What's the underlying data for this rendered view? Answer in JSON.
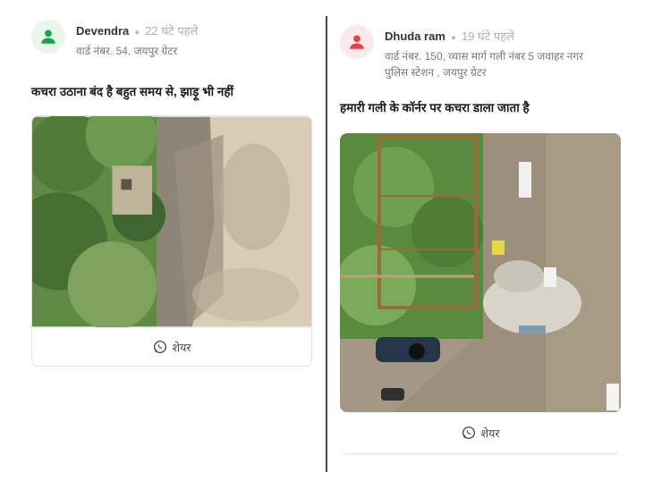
{
  "posts": [
    {
      "author": "Devendra",
      "time": "22 घंटे पहले",
      "ward": "वार्ड नंबर. 54, जयपुर ग्रेटर",
      "text": "कचरा उठाना बंद है बहुत समय से, झाड़ू भी नहीं",
      "share_label": "शेयर",
      "avatar_color": "#19a34a",
      "avatar_bg": "#e8f6ec",
      "avatar_icon": "user-icon"
    },
    {
      "author": "Dhuda ram",
      "time": "19 घंटे पहले",
      "ward_line1": "वार्ड नंबर. 150, व्यास मार्ग गली नंबर 5 जवाहर नगर",
      "ward_line2": "पुलिस स्टेशन , जयपुर ग्रेटर",
      "text": "हमारी गली के कॉर्नर पर कचरा डाला जाता है",
      "share_label": "शेयर",
      "avatar_color": "#e0444c",
      "avatar_bg": "#fde9ea",
      "avatar_icon": "user-icon"
    }
  ]
}
